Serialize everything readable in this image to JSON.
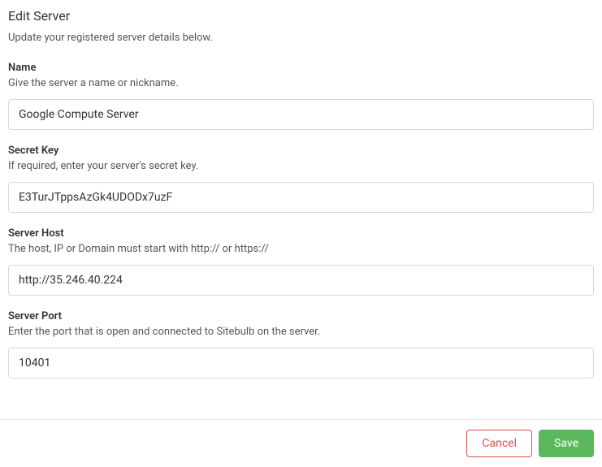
{
  "header": {
    "title": "Edit Server",
    "subtitle": "Update your registered server details below."
  },
  "fields": {
    "name": {
      "label": "Name",
      "help": "Give the server a name or nickname.",
      "value": "Google Compute Server"
    },
    "secret_key": {
      "label": "Secret Key",
      "help": "If required, enter your server's secret key.",
      "value": "E3TurJTppsAzGk4UDODx7uzF"
    },
    "server_host": {
      "label": "Server Host",
      "help": "The host, IP or Domain must start with http:// or https://",
      "value": "http://35.246.40.224"
    },
    "server_port": {
      "label": "Server Port",
      "help": "Enter the port that is open and connected to Sitebulb on the server.",
      "value": "10401"
    }
  },
  "footer": {
    "cancel_label": "Cancel",
    "save_label": "Save"
  }
}
